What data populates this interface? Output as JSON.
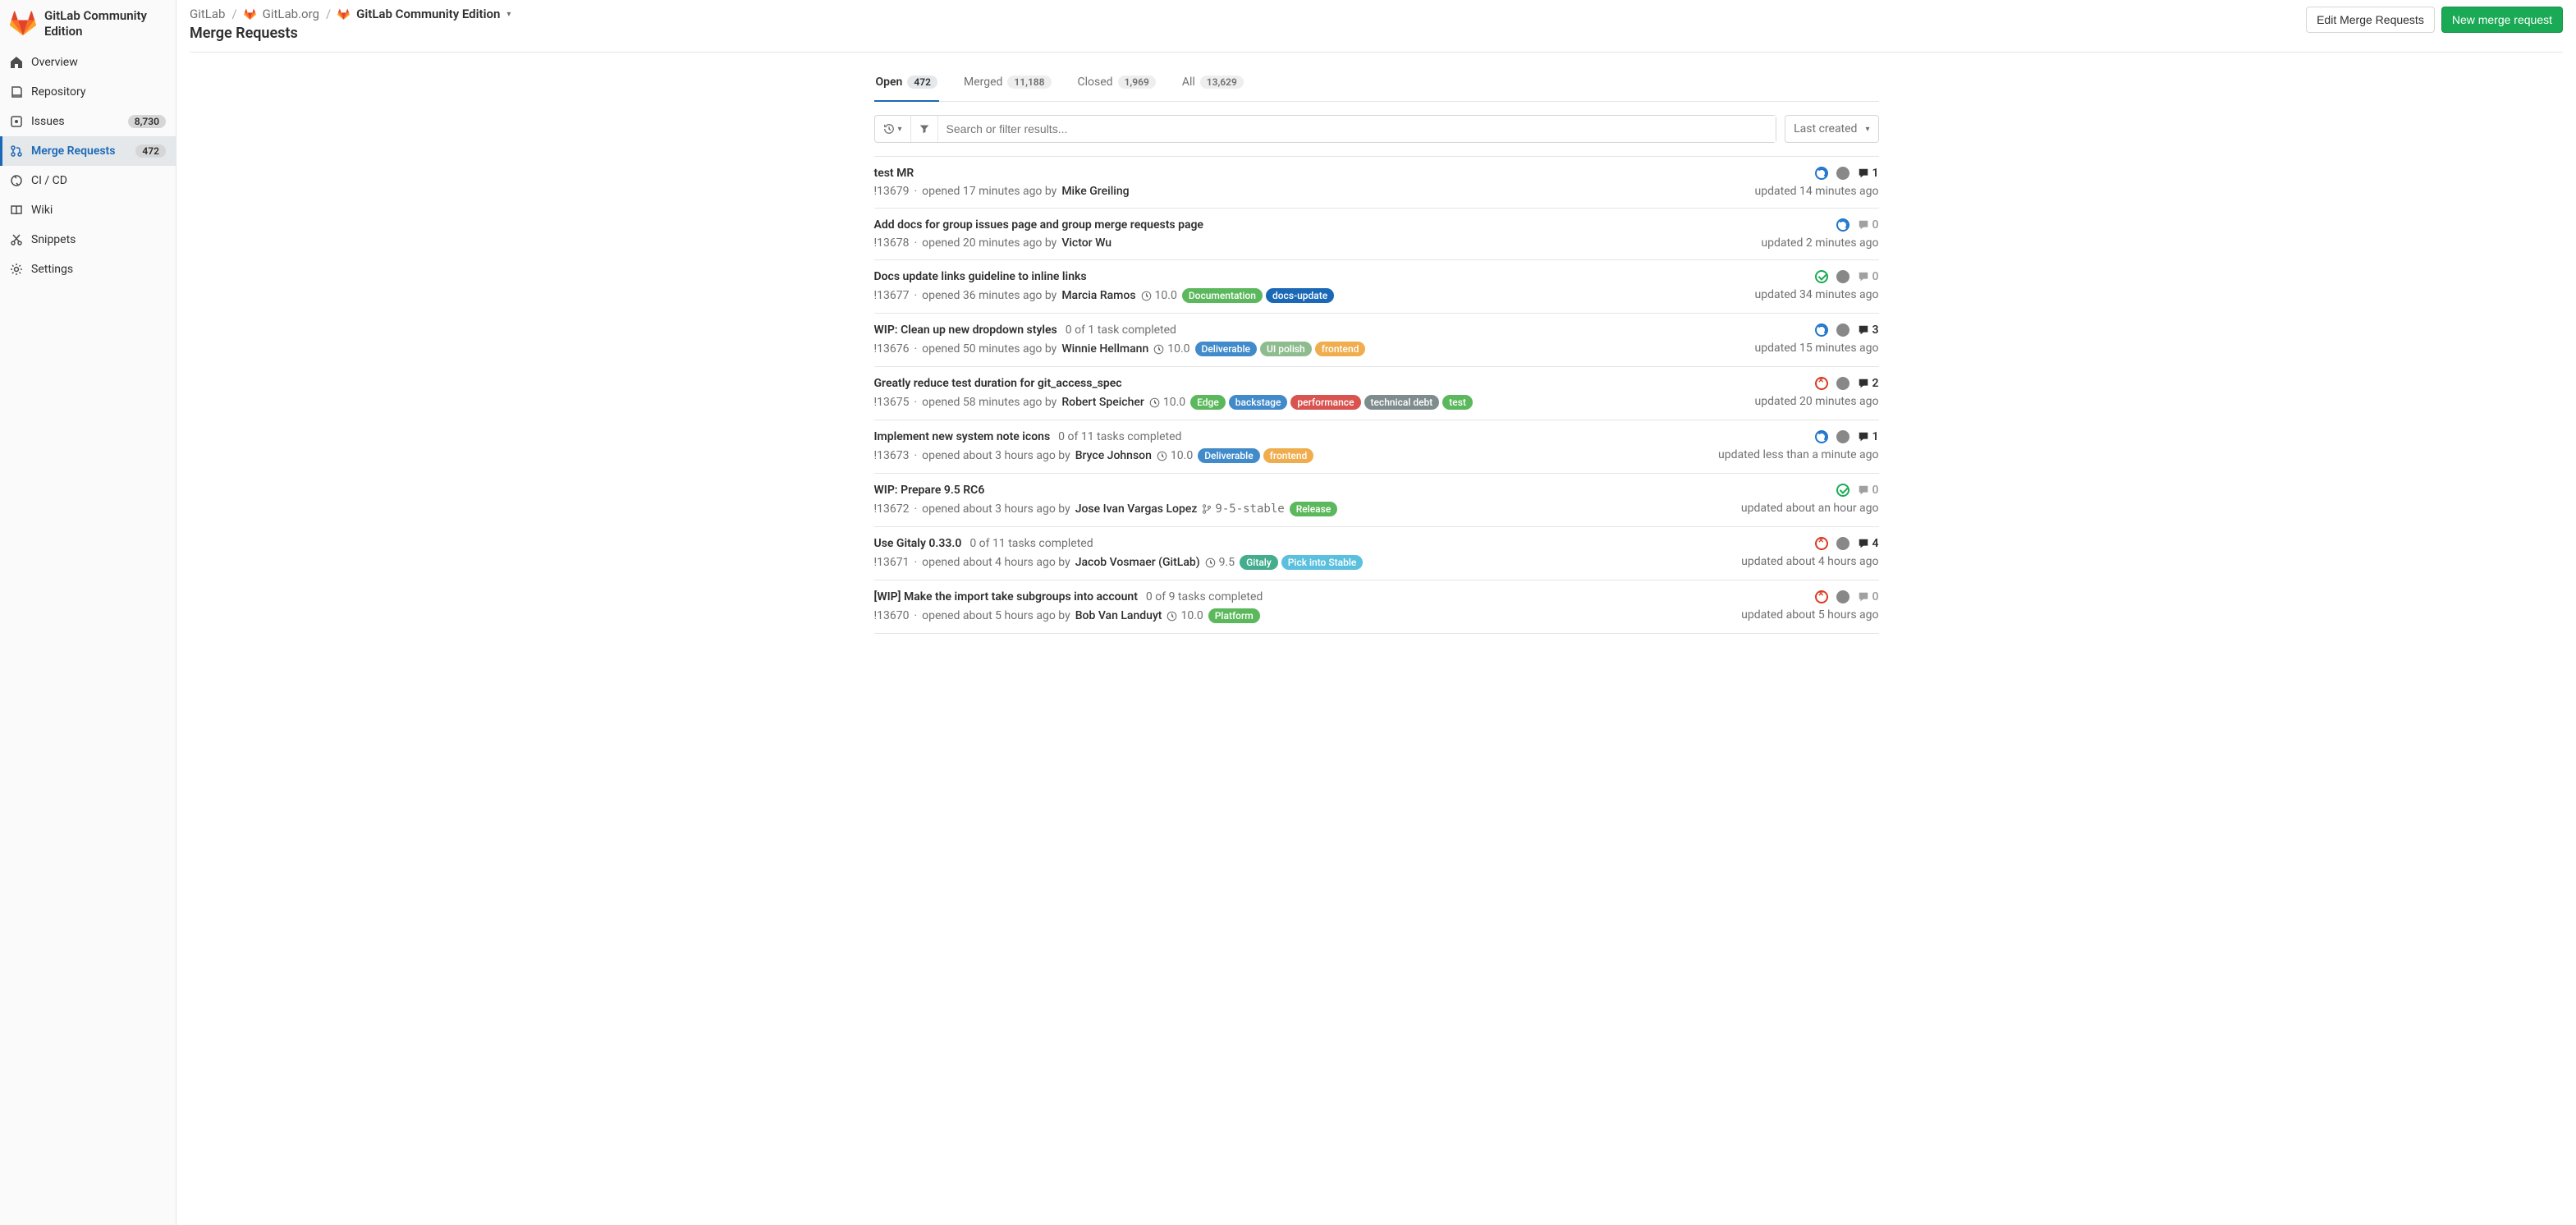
{
  "sidebar": {
    "title": "GitLab Community Edition",
    "items": [
      {
        "label": "Overview"
      },
      {
        "label": "Repository"
      },
      {
        "label": "Issues",
        "badge": "8,730"
      },
      {
        "label": "Merge Requests",
        "badge": "472",
        "active": true
      },
      {
        "label": "CI / CD"
      },
      {
        "label": "Wiki"
      },
      {
        "label": "Snippets"
      },
      {
        "label": "Settings"
      }
    ]
  },
  "breadcrumb": {
    "root": "GitLab",
    "group": "GitLab.org",
    "project": "GitLab Community Edition"
  },
  "page_title": "Merge Requests",
  "actions": {
    "edit": "Edit Merge Requests",
    "new": "New merge request"
  },
  "tabs": [
    {
      "label": "Open",
      "count": "472",
      "active": true
    },
    {
      "label": "Merged",
      "count": "11,188"
    },
    {
      "label": "Closed",
      "count": "1,969"
    },
    {
      "label": "All",
      "count": "13,629"
    }
  ],
  "filter": {
    "placeholder": "Search or filter results...",
    "sort": "Last created"
  },
  "label_colors": {
    "Documentation": "#5cb85c",
    "docs-update": "#1b69b6",
    "Deliverable": "#428bca",
    "UI polish": "#8fbc8f",
    "frontend": "#f0ad4e",
    "Edge": "#5cb85c",
    "backstage": "#428bca",
    "performance": "#d9534f",
    "technical debt": "#7f8c8d",
    "test": "#5cb85c",
    "Release": "#5cb85c",
    "Gitaly": "#44ad8e",
    "Pick into Stable": "#5bc0de",
    "Platform": "#5cb85c"
  },
  "mrs": [
    {
      "title": "test MR",
      "ref": "!13679",
      "opened": "opened 17 minutes ago by",
      "author": "Mike Greiling",
      "ci": "running",
      "assignee": true,
      "comments": 1,
      "updated": "updated 14 minutes ago"
    },
    {
      "title": "Add docs for group issues page and group merge requests page",
      "ref": "!13678",
      "opened": "opened 20 minutes ago by",
      "author": "Victor Wu",
      "ci": "running",
      "comments": 0,
      "updated": "updated 2 minutes ago"
    },
    {
      "title": "Docs update links guideline to inline links",
      "ref": "!13677",
      "opened": "opened 36 minutes ago by",
      "author": "Marcia Ramos",
      "milestone": "10.0",
      "labels": [
        "Documentation",
        "docs-update"
      ],
      "ci": "success",
      "assignee": true,
      "comments": 0,
      "updated": "updated 34 minutes ago"
    },
    {
      "title": "WIP: Clean up new dropdown styles",
      "tasks": "0 of 1 task completed",
      "ref": "!13676",
      "opened": "opened 50 minutes ago by",
      "author": "Winnie Hellmann",
      "milestone": "10.0",
      "labels": [
        "Deliverable",
        "UI polish",
        "frontend"
      ],
      "ci": "running",
      "assignee": true,
      "comments": 3,
      "updated": "updated 15 minutes ago"
    },
    {
      "title": "Greatly reduce test duration for git_access_spec",
      "ref": "!13675",
      "opened": "opened 58 minutes ago by",
      "author": "Robert Speicher",
      "milestone": "10.0",
      "labels": [
        "Edge",
        "backstage",
        "performance",
        "technical debt",
        "test"
      ],
      "ci": "failed",
      "assignee": true,
      "comments": 2,
      "updated": "updated 20 minutes ago"
    },
    {
      "title": "Implement new system note icons",
      "tasks": "0 of 11 tasks completed",
      "ref": "!13673",
      "opened": "opened about 3 hours ago by",
      "author": "Bryce Johnson",
      "milestone": "10.0",
      "labels": [
        "Deliverable",
        "frontend"
      ],
      "ci": "running",
      "assignee": true,
      "comments": 1,
      "updated": "updated less than a minute ago"
    },
    {
      "title": "WIP: Prepare 9.5 RC6",
      "ref": "!13672",
      "opened": "opened about 3 hours ago by",
      "author": "Jose Ivan Vargas Lopez",
      "branch": "9-5-stable",
      "labels": [
        "Release"
      ],
      "ci": "success",
      "comments": 0,
      "updated": "updated about an hour ago"
    },
    {
      "title": "Use Gitaly 0.33.0",
      "tasks": "0 of 11 tasks completed",
      "ref": "!13671",
      "opened": "opened about 4 hours ago by",
      "author": "Jacob Vosmaer (GitLab)",
      "milestone": "9.5",
      "labels": [
        "Gitaly",
        "Pick into Stable"
      ],
      "ci": "failed",
      "assignee": true,
      "comments": 4,
      "updated": "updated about 4 hours ago"
    },
    {
      "title": "[WIP] Make the import take subgroups into account",
      "tasks": "0 of 9 tasks completed",
      "ref": "!13670",
      "opened": "opened about 5 hours ago by",
      "author": "Bob Van Landuyt",
      "milestone": "10.0",
      "labels": [
        "Platform"
      ],
      "ci": "failed",
      "assignee": true,
      "comments": 0,
      "updated": "updated about 5 hours ago"
    }
  ]
}
